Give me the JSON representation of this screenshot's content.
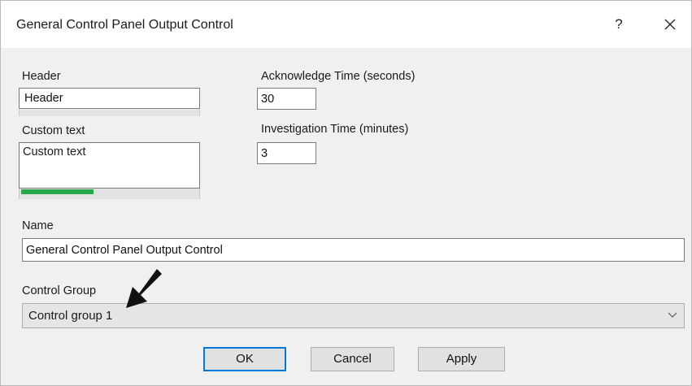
{
  "window": {
    "title": "General Control Panel Output Control",
    "help_label": "?",
    "close_icon": "close-icon"
  },
  "header": {
    "label": "Header",
    "value": "Header"
  },
  "custom_text": {
    "label": "Custom text",
    "value": "Custom text",
    "progress_fraction": 0.41
  },
  "acknowledge_time": {
    "label": "Acknowledge Time (seconds)",
    "value": "30"
  },
  "investigation_time": {
    "label": "Investigation Time (minutes)",
    "value": "3"
  },
  "name": {
    "label": "Name",
    "value": "General Control Panel Output Control"
  },
  "control_group": {
    "label": "Control Group",
    "selected": "Control group 1",
    "arrow_icon": "chevron-down-icon"
  },
  "buttons": {
    "ok": "OK",
    "cancel": "Cancel",
    "apply": "Apply"
  },
  "colors": {
    "progress": "#25a94a",
    "default_button_border": "#0078d7",
    "dialog_background": "#f0f0f0"
  }
}
